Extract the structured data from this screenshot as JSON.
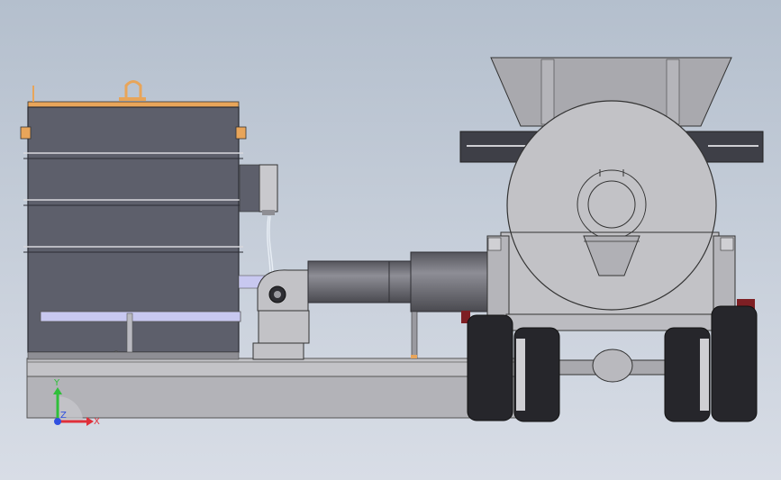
{
  "colors": {
    "bg_top": "#b4bfcd",
    "bg_bottom": "#d8dde6",
    "tank": "#5d5f6b",
    "tank_line": "#2a2b33",
    "tank_top": "#e8a55a",
    "frame": "#b7b7bb",
    "frame_dark": "#8f8f94",
    "pipe": "#707078",
    "pipe_light": "#9c9ca3",
    "drum": "#c2c2c6",
    "hopper": "#a9a9ae",
    "tire": "#26262b",
    "rim": "#cfcfd3",
    "red": "#7e1f24",
    "lavender": "#c8c8f0",
    "axis_x": "#e0303a",
    "axis_y": "#2fbf3a",
    "axis_z": "#3050e0"
  },
  "axes": {
    "x_label": "X",
    "y_label": "Y",
    "z_label": "Z"
  }
}
